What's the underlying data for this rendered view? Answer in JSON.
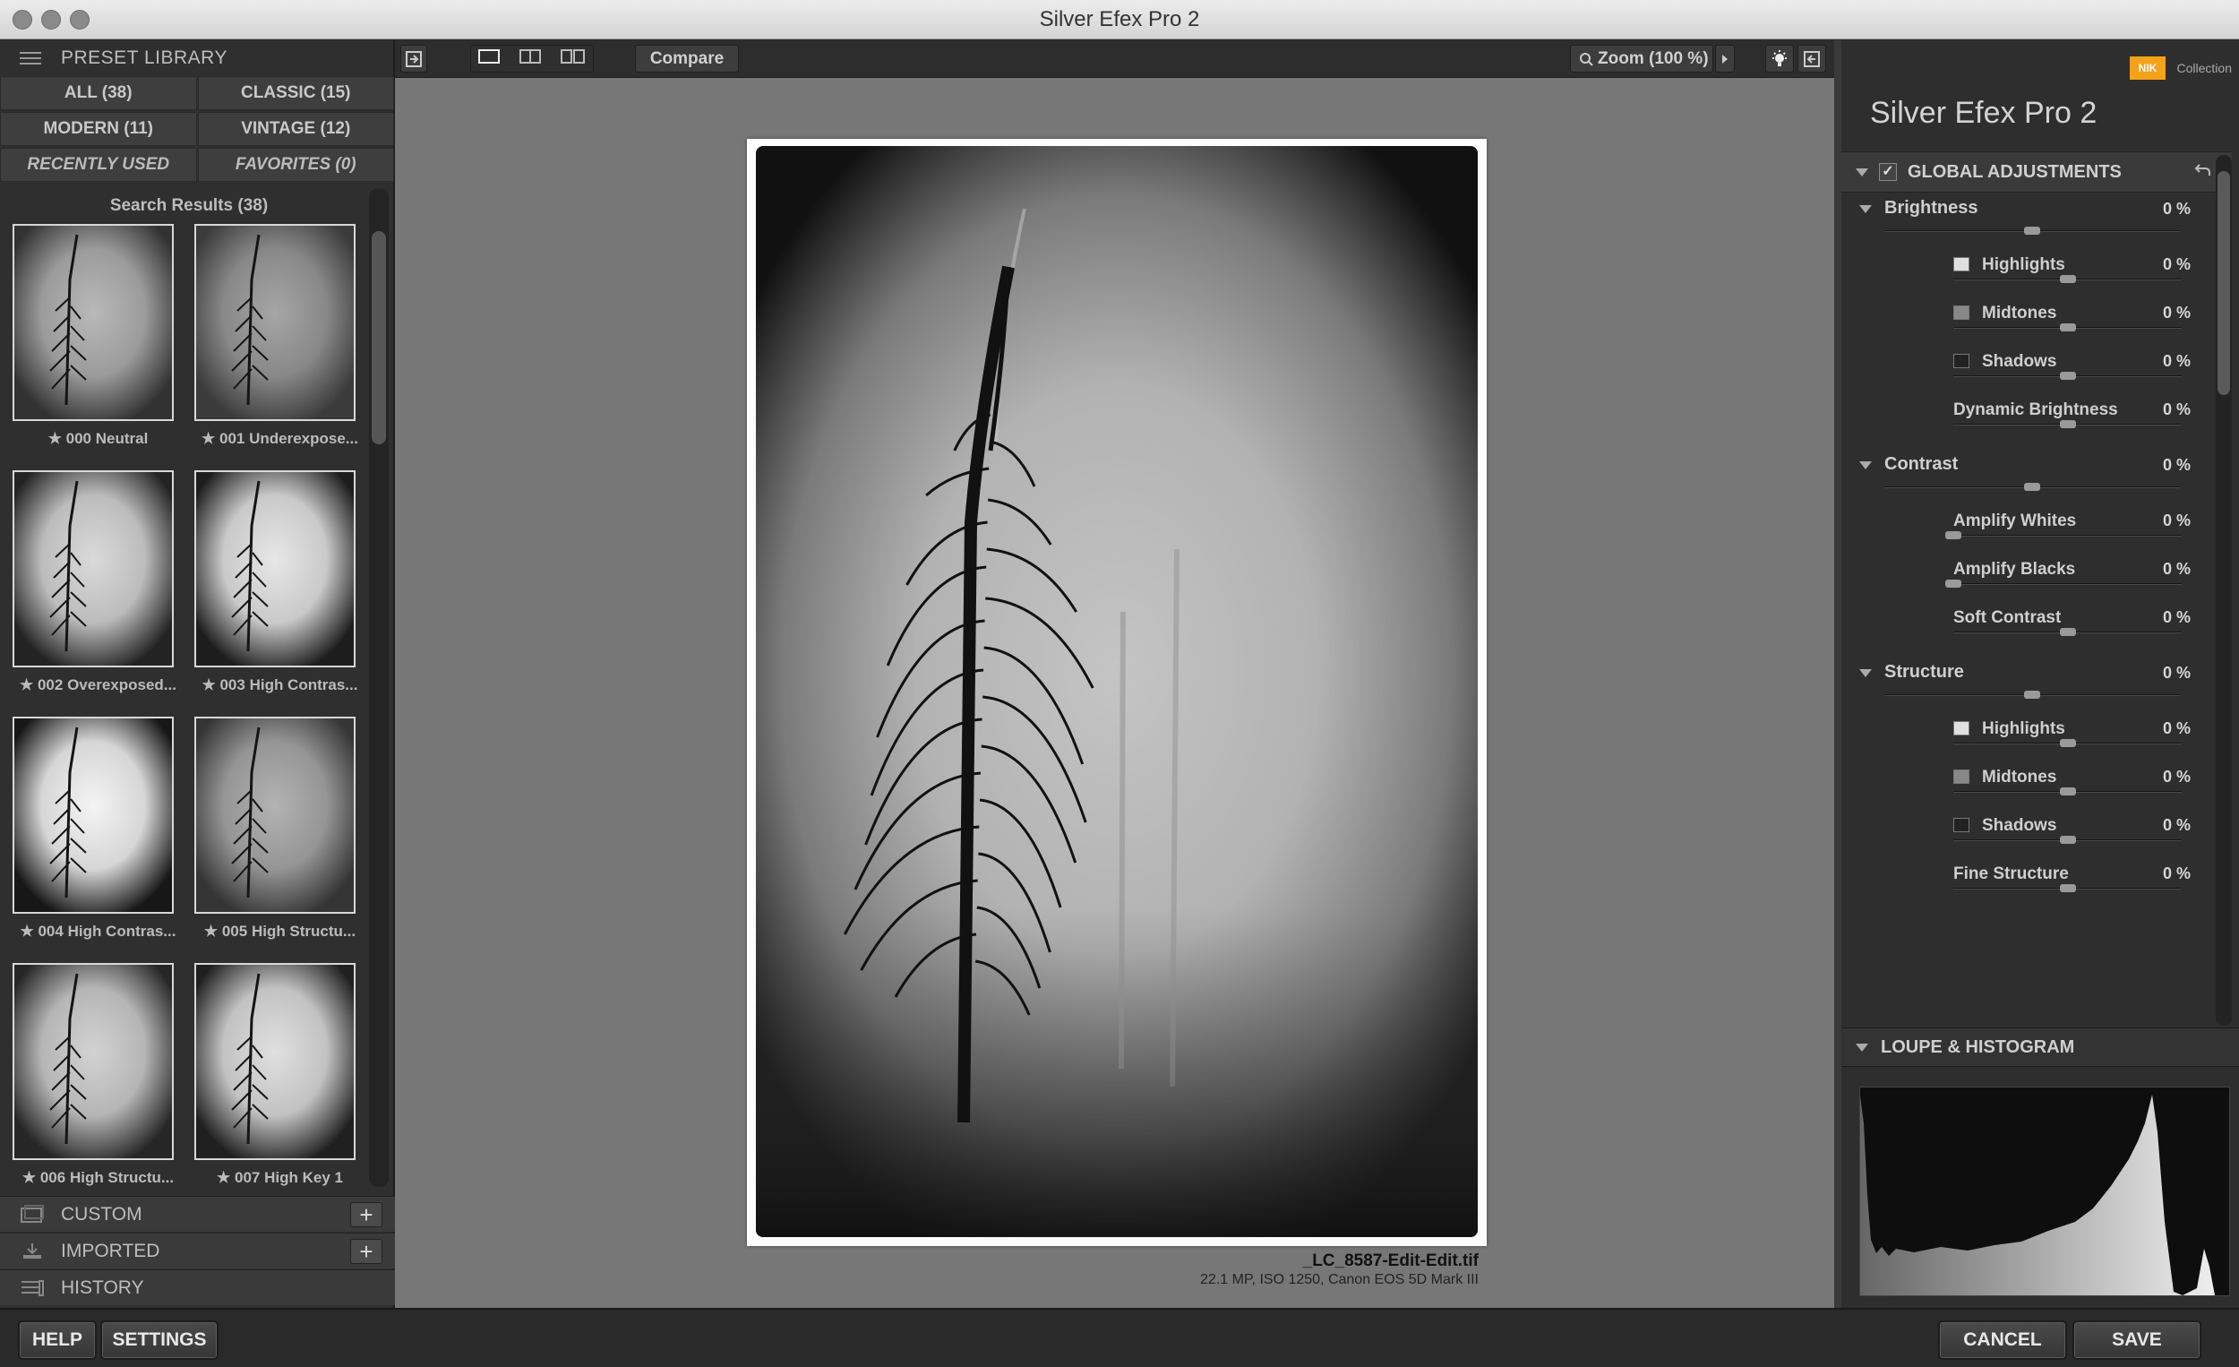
{
  "window": {
    "title": "Silver Efex Pro 2"
  },
  "left_panel": {
    "header": "PRESET LIBRARY",
    "filters": {
      "all": "ALL (38)",
      "classic": "CLASSIC (15)",
      "modern": "MODERN (11)",
      "vintage": "VINTAGE (12)",
      "recent": "RECENTLY USED",
      "favorites": "FAVORITES (0)"
    },
    "results_title": "Search Results (38)",
    "presets": [
      {
        "label": "★ 000 Neutral",
        "tone": 0.5
      },
      {
        "label": "★ 001 Underexpose...",
        "tone": 0.35
      },
      {
        "label": "★ 002 Overexposed...",
        "tone": 0.75
      },
      {
        "label": "★ 003 High Contras...",
        "tone": 0.85
      },
      {
        "label": "★ 004 High Contras...",
        "tone": 0.95
      },
      {
        "label": "★ 005 High Structu...",
        "tone": 0.45
      },
      {
        "label": "★ 006 High Structu...",
        "tone": 0.7
      },
      {
        "label": "★ 007 High Key 1",
        "tone": 0.8
      }
    ],
    "sections": {
      "custom": "CUSTOM",
      "imported": "IMPORTED",
      "history": "HISTORY"
    }
  },
  "toolbar": {
    "compare": "Compare",
    "zoom": "Zoom (100 %)"
  },
  "image": {
    "filename": "_LC_8587-Edit-Edit.tif",
    "meta": "22.1 MP, ISO 1250, Canon EOS 5D Mark III"
  },
  "right_panel": {
    "brand": "Silver Efex Pro",
    "brand_num": "2",
    "nik": "NIK",
    "collection": "Collection",
    "global_adjustments": "GLOBAL ADJUSTMENTS",
    "adjustments": [
      {
        "name": "Brightness",
        "value": "0 %",
        "level": 0.5,
        "main": true
      },
      {
        "name": "Highlights",
        "value": "0 %",
        "level": 0.5,
        "swatch": "#e0e0e0"
      },
      {
        "name": "Midtones",
        "value": "0 %",
        "level": 0.5,
        "swatch": "#888888"
      },
      {
        "name": "Shadows",
        "value": "0 %",
        "level": 0.5,
        "swatch": "#222222"
      },
      {
        "name": "Dynamic Brightness",
        "value": "0 %",
        "level": 0.5
      },
      {
        "name": "Contrast",
        "value": "0 %",
        "level": 0.5,
        "main": true
      },
      {
        "name": "Amplify Whites",
        "value": "0 %",
        "level": 0.0
      },
      {
        "name": "Amplify Blacks",
        "value": "0 %",
        "level": 0.0
      },
      {
        "name": "Soft Contrast",
        "value": "0 %",
        "level": 0.5
      },
      {
        "name": "Structure",
        "value": "0 %",
        "level": 0.5,
        "main": true
      },
      {
        "name": "Highlights",
        "value": "0 %",
        "level": 0.5,
        "swatch": "#e0e0e0"
      },
      {
        "name": "Midtones",
        "value": "0 %",
        "level": 0.5,
        "swatch": "#888888"
      },
      {
        "name": "Shadows",
        "value": "0 %",
        "level": 0.5,
        "swatch": "#222222"
      },
      {
        "name": "Fine Structure",
        "value": "0 %",
        "level": 0.5
      }
    ],
    "loupe": "LOUPE & HISTOGRAM"
  },
  "bottom": {
    "help": "HELP",
    "settings": "SETTINGS",
    "cancel": "CANCEL",
    "save": "SAVE"
  },
  "colors": {
    "accent": "#f5a21b",
    "panel": "#2e2e2e",
    "canvas": "#777777"
  }
}
